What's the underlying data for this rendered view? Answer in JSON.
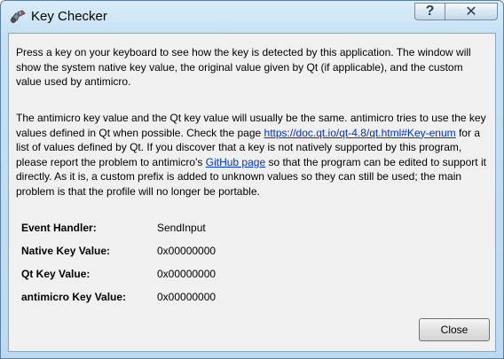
{
  "window": {
    "title": "Key Checker"
  },
  "titlebar": {
    "help_glyph": "?",
    "close_glyph": "✕"
  },
  "description": {
    "p1": "Press a key on your keyboard to see how the key is detected by this application. The window will show the system native key value, the original value given by Qt (if applicable), and the custom value used by antimicro.",
    "p2_a": "The antimicro key value and the Qt key value will usually be the same. antimicro tries to use the key values defined in Qt when possible. Check the page ",
    "p2_link1": "https://doc.qt.io/qt-4.8/qt.html#Key-enum",
    "p2_b": " for a list of values defined by Qt. If you discover that a key is not natively supported by this program, please report the problem to antimicro's ",
    "p2_link2": "GitHub page",
    "p2_c": " so that the program can be edited to support it directly. As it is, a custom prefix is added to unknown values so they can still be used; the main problem is that the profile will no longer be portable."
  },
  "fields": [
    {
      "label": "Event Handler:",
      "value": "SendInput"
    },
    {
      "label": "Native Key Value:",
      "value": "0x00000000"
    },
    {
      "label": "Qt Key Value:",
      "value": "0x00000000"
    },
    {
      "label": "antimicro Key Value:",
      "value": "0x00000000"
    }
  ],
  "buttons": {
    "close_label": "Close"
  },
  "icons": {
    "app": "gamepad-icon",
    "help": "help-icon",
    "close": "close-icon"
  }
}
